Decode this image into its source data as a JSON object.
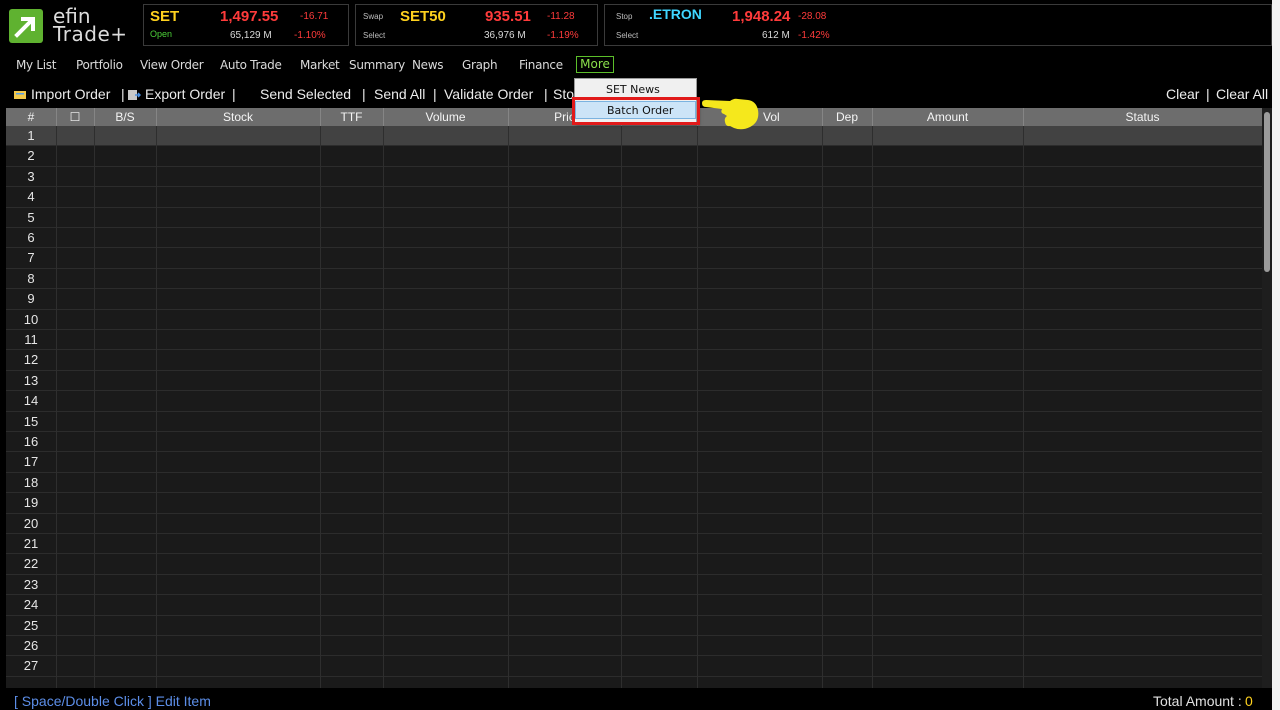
{
  "app": {
    "logo_top": "efin",
    "logo_bottom": "Trade+"
  },
  "indices": [
    {
      "small_label": "",
      "status": "Open",
      "name": "SET",
      "price": "1,497.55",
      "change": "-16.71",
      "volume": "65,129 M",
      "percent": "-1.10%"
    },
    {
      "small_label": "Swap",
      "status": "Select",
      "name": "SET50",
      "price": "935.51",
      "change": "-11.28",
      "volume": "36,976 M",
      "percent": "-1.19%"
    },
    {
      "small_label": "Stop",
      "status": "Select",
      "name": ".ETRON",
      "price": "1,948.24",
      "change": "-28.08",
      "volume": "612 M",
      "percent": "-1.42%"
    }
  ],
  "menu": [
    "My List",
    "Portfolio",
    "View Order",
    "Auto Trade",
    "Market",
    "Summary",
    "News",
    "Graph",
    "Finance",
    "More"
  ],
  "toolbar": {
    "import": "Import Order",
    "export": "Export Order",
    "send_selected": "Send Selected",
    "send_all": "Send All",
    "validate": "Validate Order",
    "stop": "Sto",
    "clear": "Clear",
    "clear_all": "Clear All",
    "sep": "|"
  },
  "columns": [
    "#",
    "☐",
    "B/S",
    "Stock",
    "TTF",
    "Volume",
    "Pric",
    "",
    "Vol",
    "Dep",
    "Amount",
    "Status"
  ],
  "rows": [
    "1",
    "2",
    "3",
    "4",
    "5",
    "6",
    "7",
    "8",
    "9",
    "10",
    "11",
    "12",
    "13",
    "14",
    "15",
    "16",
    "17",
    "18",
    "19",
    "20",
    "21",
    "22",
    "23",
    "24",
    "25",
    "26",
    "27"
  ],
  "dropdown": {
    "items": [
      "SET News",
      "Batch Order"
    ],
    "highlighted": "Batch Order"
  },
  "status": {
    "hint": "[ Space/Double Click ]  Edit Item",
    "total_label": "Total Amount :",
    "total_value": "0"
  },
  "colors": {
    "accent_green": "#5fb230",
    "index_yellow": "#ffd21e",
    "down_red": "#ff3b3b",
    "highlight_red": "#e11a1a"
  }
}
